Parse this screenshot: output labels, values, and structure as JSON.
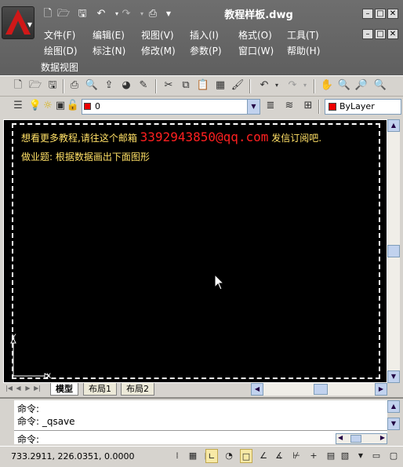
{
  "titlebar": {
    "document_title": "教程样板.dwg",
    "quick_access": [
      "new-icon",
      "open-icon",
      "save-icon",
      "undo-icon",
      "redo-icon",
      "plot-icon"
    ],
    "window_buttons": [
      "–",
      "□",
      "✕"
    ],
    "doc_buttons": [
      "–",
      "□",
      "✕"
    ]
  },
  "menu": {
    "row1": [
      "文件(F)",
      "编辑(E)",
      "视图(V)",
      "插入(I)",
      "格式(O)",
      "工具(T)"
    ],
    "row2": [
      "绘图(D)",
      "标注(N)",
      "修改(M)",
      "参数(P)",
      "窗口(W)",
      "帮助(H)"
    ],
    "row3": [
      "数据视图"
    ]
  },
  "layer": {
    "name": "0",
    "color": "#e00000",
    "color_label": "ByLayer"
  },
  "canvas": {
    "line1_prefix": "想看更多教程,请往这个邮箱",
    "email": "3392943850@qq.com",
    "line1_suffix": "发信订阅吧.",
    "line2": "做业题: 根据数据画出下面图形",
    "ucs_x": "X",
    "ucs_y": "Y"
  },
  "tabs": [
    {
      "label": "模型",
      "active": true
    },
    {
      "label": "布局1",
      "active": false
    },
    {
      "label": "布局2",
      "active": false
    }
  ],
  "command": {
    "history": [
      "命令:",
      "命令: _qsave"
    ],
    "prompt": "命令:"
  },
  "status": {
    "coords": "733.2911, 226.0351, 0.0000"
  }
}
